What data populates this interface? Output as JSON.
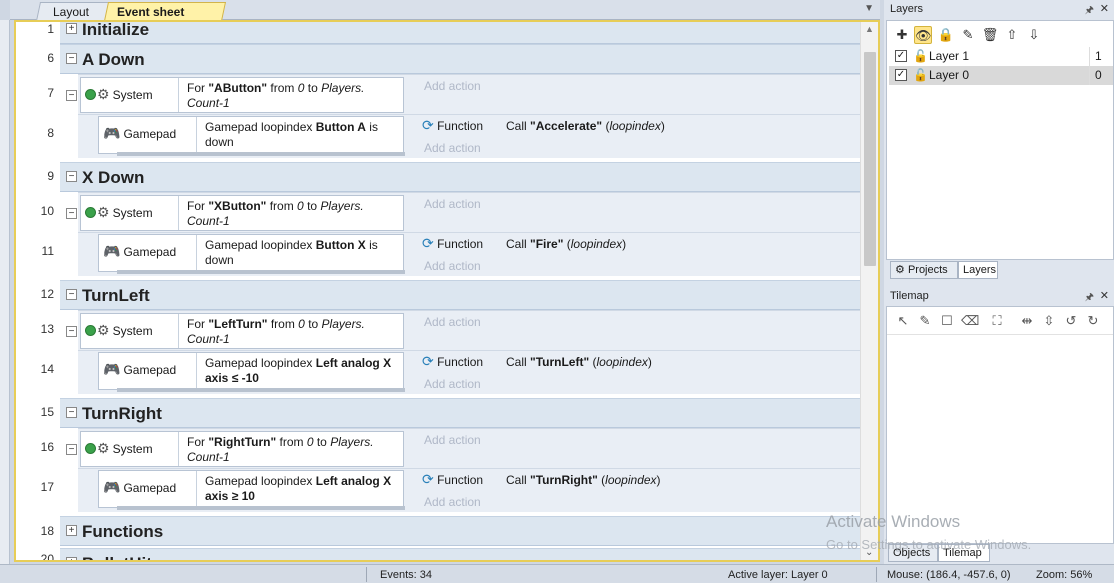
{
  "tabs": [
    {
      "label": "Layout 1"
    },
    {
      "label": "Event sheet 1",
      "close": "✕"
    }
  ],
  "sheet": {
    "top_group": {
      "line": "",
      "title": "Initialize"
    },
    "groups": [
      {
        "group_line": "6",
        "title": "A Down",
        "system": {
          "line": "7",
          "object": "System",
          "text_pre": "For ",
          "text_bold": "\"AButton\"",
          "text_mid": " from ",
          "text_it1": "0",
          "text_mid2": " to ",
          "text_it2": "Players.",
          "text_line2": "Count-1",
          "add_action": "Add action"
        },
        "gamepad": {
          "line": "8",
          "object": "Gamepad",
          "cond_pre": "Gamepad loopindex ",
          "cond_bold": "Button A",
          "cond_post": " is",
          "cond_line2": "down",
          "act_object": "Function",
          "act_pre": "Call ",
          "act_bold": "\"Accelerate\"",
          "act_post": " (",
          "act_it": "loopindex",
          "act_close": ")",
          "add_action": "Add action"
        }
      },
      {
        "group_line": "9",
        "title": "X Down",
        "system": {
          "line": "10",
          "object": "System",
          "text_pre": "For ",
          "text_bold": "\"XButton\"",
          "text_mid": " from ",
          "text_it1": "0",
          "text_mid2": " to ",
          "text_it2": "Players.",
          "text_line2": "Count-1",
          "add_action": "Add action"
        },
        "gamepad": {
          "line": "11",
          "object": "Gamepad",
          "cond_pre": "Gamepad loopindex ",
          "cond_bold": "Button X",
          "cond_post": " is",
          "cond_line2": "down",
          "act_object": "Function",
          "act_pre": "Call ",
          "act_bold": "\"Fire\"",
          "act_post": " (",
          "act_it": "loopindex",
          "act_close": ")",
          "add_action": "Add action"
        }
      },
      {
        "group_line": "12",
        "title": "TurnLeft",
        "system": {
          "line": "13",
          "object": "System",
          "text_pre": "For ",
          "text_bold": "\"LeftTurn\"",
          "text_mid": " from ",
          "text_it1": "0",
          "text_mid2": " to ",
          "text_it2": "Players.",
          "text_line2": "Count-1",
          "add_action": "Add action"
        },
        "gamepad": {
          "line": "14",
          "object": "Gamepad",
          "cond_pre": "Gamepad loopindex ",
          "cond_bold": "Left analog X",
          "cond_post": "",
          "cond_line2": "axis ≤ -10",
          "act_object": "Function",
          "act_pre": "Call ",
          "act_bold": "\"TurnLeft\"",
          "act_post": " (",
          "act_it": "loopindex",
          "act_close": ")",
          "add_action": "Add action"
        }
      },
      {
        "group_line": "15",
        "title": "TurnRight",
        "system": {
          "line": "16",
          "object": "System",
          "text_pre": "For ",
          "text_bold": "\"RightTurn\"",
          "text_mid": " from ",
          "text_it1": "0",
          "text_mid2": " to ",
          "text_it2": "Players.",
          "text_line2": "Count-1",
          "add_action": "Add action"
        },
        "gamepad": {
          "line": "17",
          "object": "Gamepad",
          "cond_pre": "Gamepad loopindex ",
          "cond_bold": "Left analog X",
          "cond_post": "",
          "cond_line2": "axis ≥ 10",
          "act_object": "Function",
          "act_pre": "Call ",
          "act_bold": "\"TurnRight\"",
          "act_post": " (",
          "act_it": "loopindex",
          "act_close": ")",
          "add_action": "Add action"
        }
      }
    ],
    "functions_group": {
      "line": "18",
      "title": "Functions"
    },
    "partial_group": {
      "line": "20",
      "title": "BulletHit"
    }
  },
  "layers_panel": {
    "title": "Layers",
    "pin": "🖈",
    "close": "✕",
    "layers": [
      {
        "name": "Layer 1",
        "num": "1"
      },
      {
        "name": "Layer 0",
        "num": "0"
      }
    ],
    "tabs": [
      "Projects",
      "Layers"
    ]
  },
  "tilemap_panel": {
    "title": "Tilemap",
    "pin": "🖈",
    "close": "✕",
    "tabs": [
      "Objects",
      "Tilemap"
    ]
  },
  "watermark": {
    "line1": "Activate Windows",
    "line2": "Go to Settings to activate Windows."
  },
  "status": {
    "events": "Events: 34",
    "active_layer": "Active layer: Layer 0",
    "mouse": "Mouse: (186.4, -457.6, 0)",
    "zoom": "Zoom: 56%"
  },
  "colors": {
    "group_bg": "#dce6f0",
    "active_tab": "#fff2a8",
    "frame_border": "#e7cd57",
    "add_action": "#b0b8c8"
  }
}
